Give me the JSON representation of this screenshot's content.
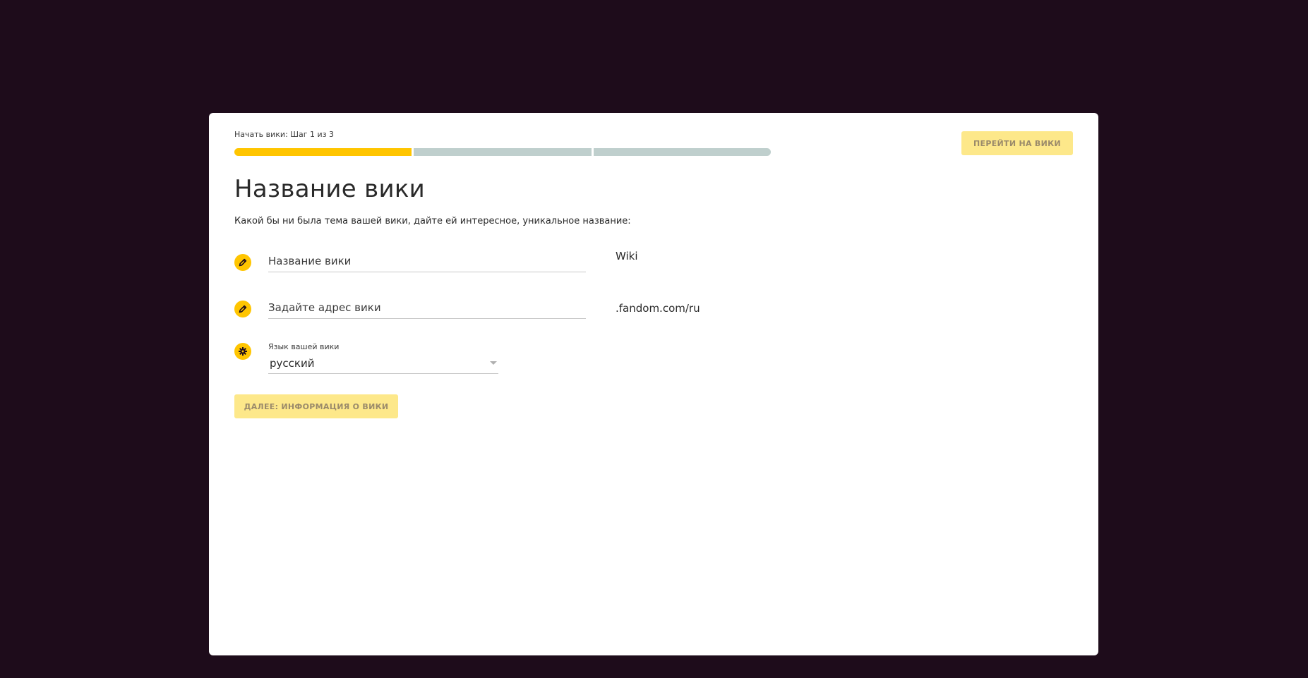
{
  "header": {
    "step_label": "Начать вики: Шаг 1 из 3",
    "progress": {
      "current_step": 1,
      "total_steps": 3
    },
    "goto_wiki_label": "ПЕРЕЙТИ НА ВИКИ"
  },
  "main": {
    "title": "Название вики",
    "subtitle": "Какой бы ни была тема вашей вики, дайте ей интересное, уникальное название:",
    "wiki_name": {
      "icon": "pencil-icon",
      "value": "",
      "placeholder": "Название вики",
      "suffix": "Wiki"
    },
    "wiki_address": {
      "icon": "pencil-icon",
      "value": "",
      "placeholder": "Задайте адрес вики",
      "suffix": ".fandom.com/ru"
    },
    "language": {
      "icon": "gear-icon",
      "label": "Язык вашей вики",
      "selected": "русский"
    },
    "next_label": "ДАЛЕЕ: ИНФОРМАЦИЯ О ВИКИ"
  },
  "colors": {
    "background": "#1e0c1b",
    "accent": "#ffc500",
    "accent_disabled": "#fde88a",
    "progress_inactive": "#bfcfcd"
  }
}
